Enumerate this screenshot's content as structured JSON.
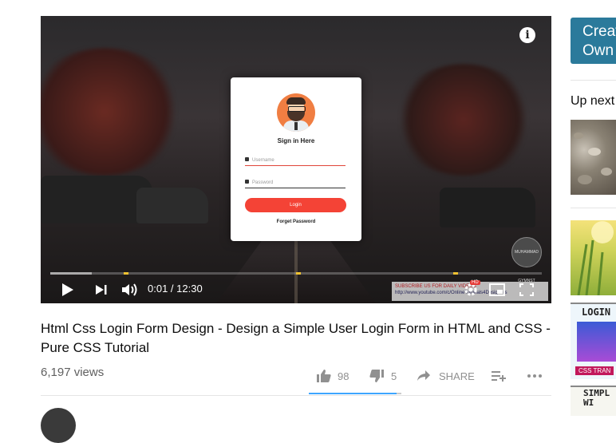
{
  "player": {
    "info_icon": "info-icon",
    "login_card": {
      "title": "Sign in Here",
      "username_placeholder": "Username",
      "password_placeholder": "Password",
      "login_button": "Login",
      "forget_link": "Forget Password"
    },
    "watermark_text": "MUHAMMAD GYMNST",
    "subscribe_text": "SUBSCRIBE US FOR DAILY VIDEOS",
    "subscribe_url": "http://www.youtube.com/c/OnlineTutorials4Designers",
    "progress": {
      "played_fraction": 0.001,
      "loaded_fraction": 0.085,
      "chapter_marks": [
        0.15,
        0.5,
        0.82
      ]
    },
    "time": "0:01 / 12:30",
    "hd_badge": "HD",
    "accent_color": "#ff0000"
  },
  "video": {
    "title": "Html Css Login Form Design - Design a Simple User Login Form in HTML and CSS - Pure CSS Tutorial",
    "views": "6,197 views",
    "likes": "98",
    "dislikes": "5",
    "share_label": "SHARE",
    "like_fraction": 0.95,
    "sentiment_color": "#3ea6ff"
  },
  "sidebar": {
    "create_button": "Create Own",
    "up_next_label": "Up next",
    "thumbnails": [
      {
        "name": "pebbles"
      },
      {
        "name": "wheat"
      },
      {
        "title_text": "LOGIN",
        "subtitle": "CSS TRAN"
      },
      {
        "title_text": "SIMPL WI"
      }
    ]
  }
}
